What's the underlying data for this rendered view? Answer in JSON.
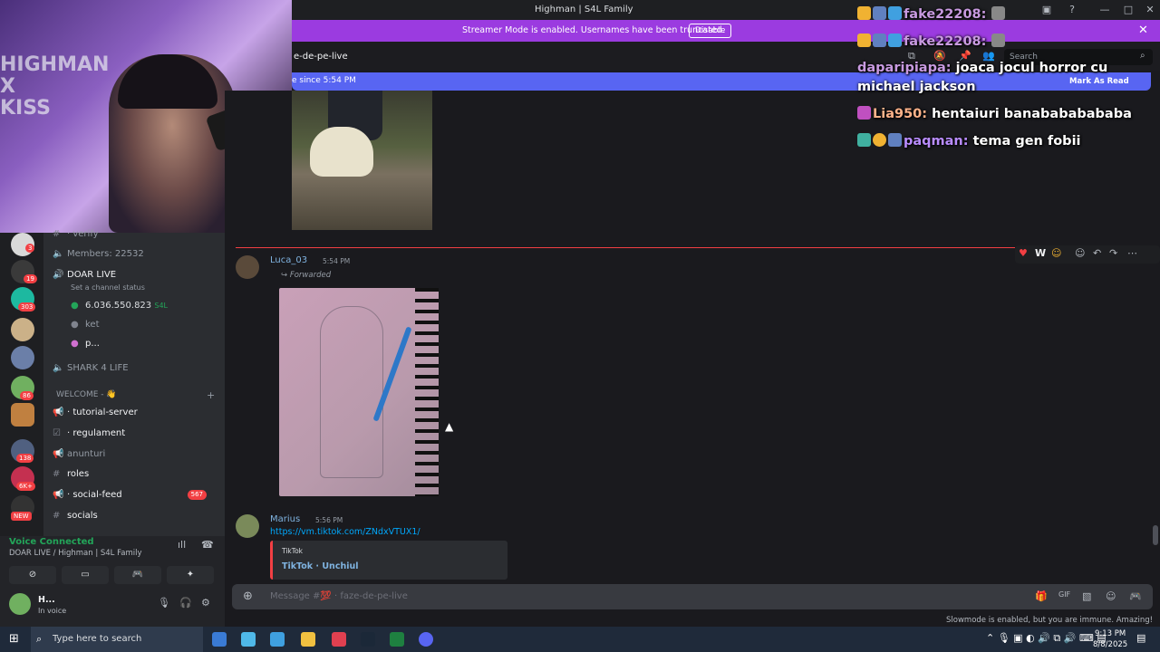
{
  "window": {
    "title": "Highman | S4L Family"
  },
  "streamer_mode": {
    "message": "Streamer Mode is enabled. Usernames have been truncated.",
    "button": "Disable"
  },
  "channel": {
    "name": "e-de-pe-live",
    "search_placeholder": "Search"
  },
  "new_messages": {
    "text": "e since 5:54 PM",
    "mark_read": "Mark As Read"
  },
  "webcam": {
    "banner": "HIGHMAN\nX\nKISS"
  },
  "servers": [
    {
      "badge": "3"
    },
    {
      "badge": "19"
    },
    {
      "badge": "303"
    },
    {
      "badge": ""
    },
    {
      "badge": ""
    },
    {
      "badge": "86"
    },
    {
      "badge": ""
    },
    {
      "badge": "138"
    },
    {
      "badge": "6K+"
    },
    {
      "badge": "NEW"
    }
  ],
  "sidebar": {
    "verify": "· verify",
    "members": "Members: 22532",
    "doar_live": "DOAR LIVE",
    "channel_status": "Set a channel status",
    "voice_users": [
      {
        "name": "6.036.550.823",
        "tag": "S4L"
      },
      {
        "name": "ket"
      },
      {
        "name": "p..."
      }
    ],
    "shark": "SHARK 4 LIFE",
    "category": "WELCOME - 👋",
    "channels": [
      {
        "label": "· tutorial-server"
      },
      {
        "label": "· regulament"
      },
      {
        "label": "anunturi"
      },
      {
        "label": "roles"
      },
      {
        "label": "· social-feed",
        "count": "567"
      },
      {
        "label": "socials"
      }
    ]
  },
  "voice": {
    "connected": "Voice Connected",
    "location": "DOAR LIVE / Highman | S4L Family"
  },
  "user": {
    "name": "H...",
    "status": "In voice"
  },
  "messages": [
    {
      "author": "Luca_03",
      "time": "5:54 PM",
      "forwarded": "Forwarded"
    },
    {
      "author": "Marius",
      "time": "5:56 PM",
      "link": "https://vm.tiktok.com/ZNdxVTUX1/",
      "embed_provider": "TikTok",
      "embed_title": "TikTok · Unchiul"
    }
  ],
  "composer": {
    "placeholder": "Message #💯 · faze-de-pe-live"
  },
  "slowmode": "Slowmode is enabled, but you are immune. Amazing!",
  "taskbar": {
    "search": "Type here to search",
    "time": "9:13 PM",
    "date": "8/8/2025"
  },
  "twitch_chat": [
    {
      "user": "fake22208:",
      "text": ""
    },
    {
      "user": "fake22208:",
      "text": ""
    },
    {
      "user": "daparipiapa:",
      "text": "joaca jocul horror cu michael jackson"
    },
    {
      "user": "Lia950:",
      "text": "hentaiuri banabababababa"
    },
    {
      "user": "paqman:",
      "text": "tema gen fobii"
    }
  ],
  "colors": {
    "accent": "#5865f2",
    "streamer_bar": "#9b3be0",
    "unread": "#f23f43",
    "voice_green": "#23a559"
  }
}
